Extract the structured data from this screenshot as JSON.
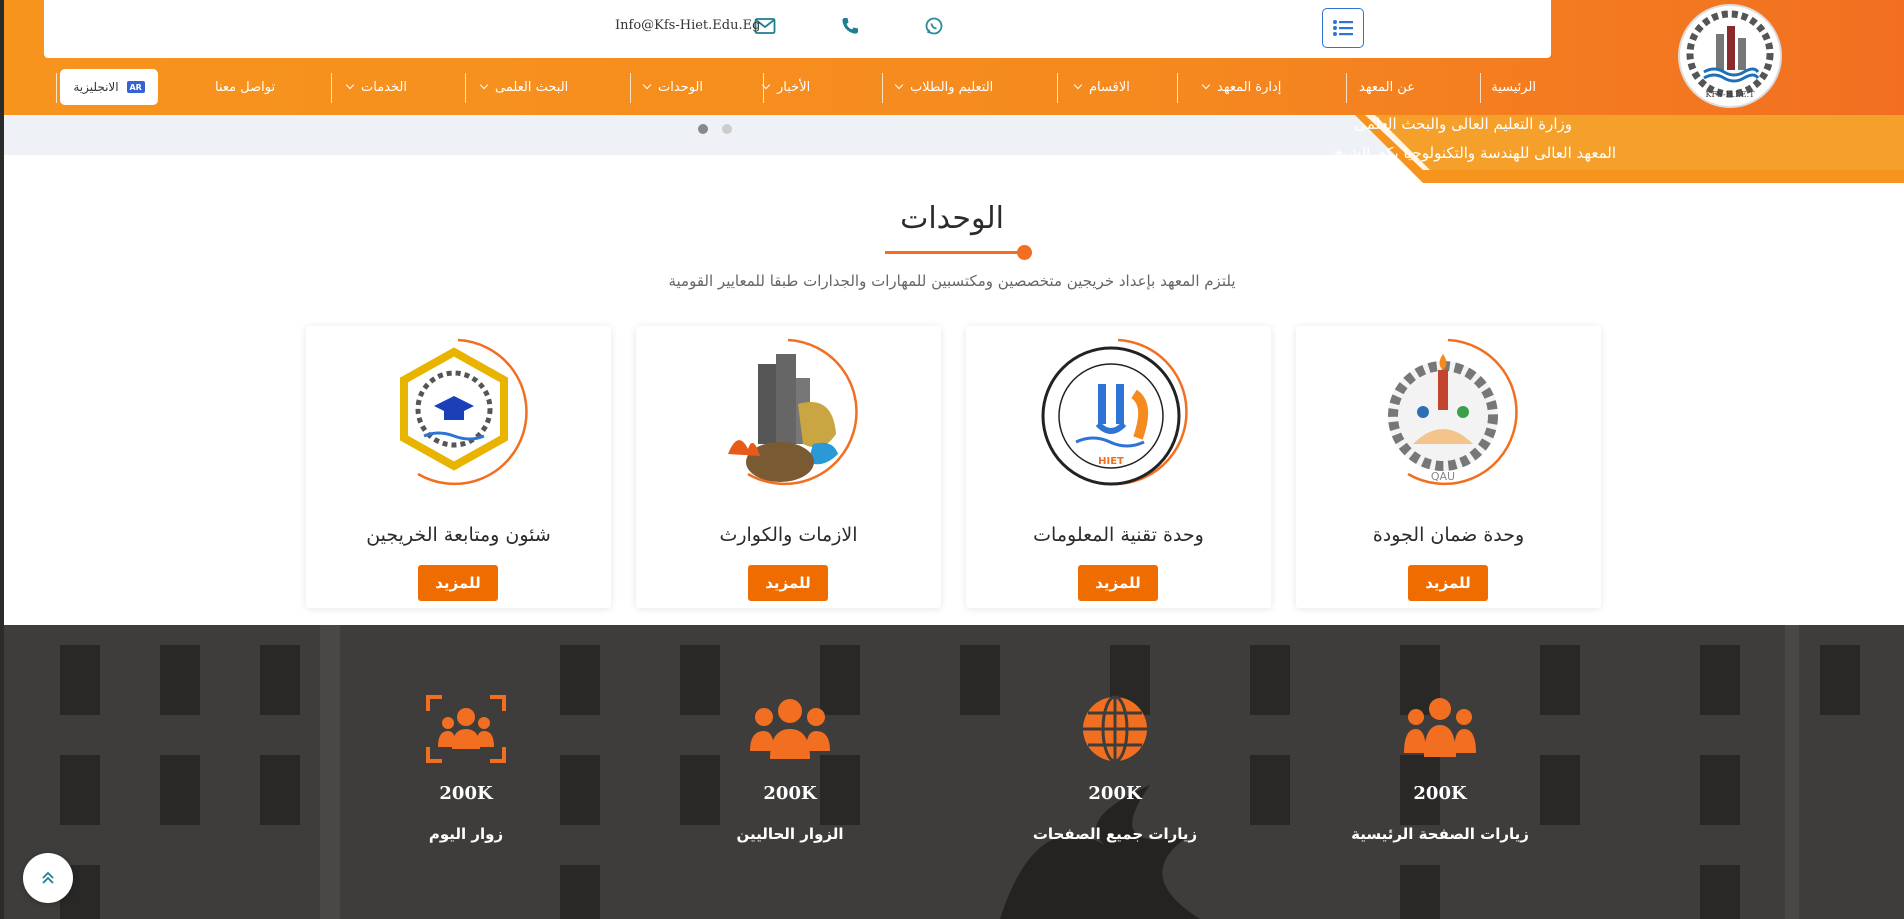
{
  "topbar": {
    "email": "Info@Kfs-Hiet.Edu.Eg",
    "icons": [
      "list-icon",
      "mail-icon",
      "phone-icon",
      "whatsapp-icon"
    ]
  },
  "brand": {
    "ministry": "وزارة التعليم العالى والبحث العلمى",
    "institute": "المعهد العالى للهندسة والتكنولوجيا بكفرالشيخ",
    "logo_text": "KFS-H.I.E.T",
    "accent_color": "#f58a1f"
  },
  "nav": {
    "items": [
      {
        "label": "الرئيسية",
        "dropdown": false
      },
      {
        "label": "عن المعهد",
        "dropdown": false
      },
      {
        "label": "إدارة المعهد",
        "dropdown": true
      },
      {
        "label": "الاقسام",
        "dropdown": true
      },
      {
        "label": "التعليم والطلاب",
        "dropdown": true
      },
      {
        "label": "الأخبار",
        "dropdown": true
      },
      {
        "label": "الوحدات",
        "dropdown": true
      },
      {
        "label": "البحث العلمى",
        "dropdown": true
      },
      {
        "label": "الخدمات",
        "dropdown": true
      },
      {
        "label": "تواصل معنا",
        "dropdown": false
      }
    ],
    "language_button": "الانجليزية",
    "language_flag": "AR"
  },
  "units": {
    "title": "الوحدات",
    "subtitle": "يلتزم المعهد بإعداد خريجين متخصصين ومكتسبين للمهارات والجدارات طبقا للمعايير القومية",
    "cards": [
      {
        "title": "وحدة ضمان الجودة",
        "button": "للمزيد",
        "logo": "QAU"
      },
      {
        "title": "وحدة تقنية المعلومات",
        "button": "للمزيد",
        "logo": "HIET"
      },
      {
        "title": "الازمات والكوارث",
        "button": "للمزيد",
        "logo": "crisis-icon"
      },
      {
        "title": "شئون ومتابعة الخريجين",
        "button": "للمزيد",
        "logo": "graduation-cap-icon"
      }
    ]
  },
  "stats": [
    {
      "value": "200K",
      "label": "زيارات الصفحة الرئيسية",
      "icon": "users-group-icon"
    },
    {
      "value": "200K",
      "label": "زيارات جميع الصفحات",
      "icon": "globe-icon"
    },
    {
      "value": "200K",
      "label": "الزوار الحاليين",
      "icon": "users-icon"
    },
    {
      "value": "200K",
      "label": "زوار اليوم",
      "icon": "users-focus-icon"
    }
  ]
}
